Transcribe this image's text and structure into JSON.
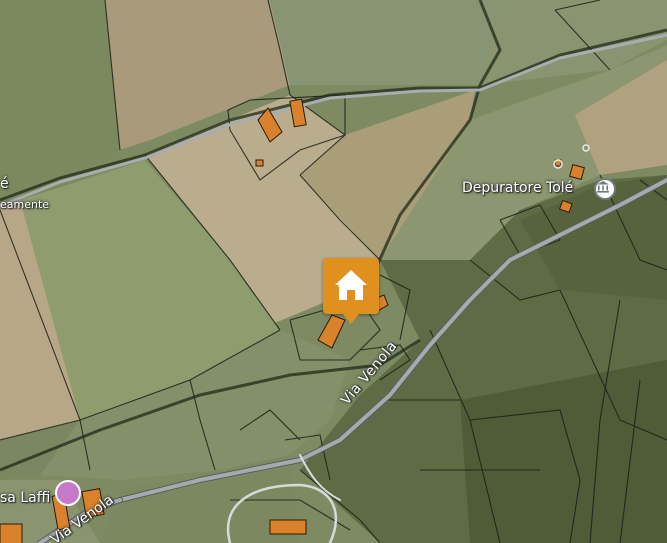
{
  "map": {
    "labels": {
      "depuratore": "Depuratore Tolé",
      "via_venola_main": "Via Venola",
      "via_venola_bottom": "Via Venola",
      "laffi": "sa Laffi",
      "edge_left_top": "é",
      "edge_left_mid": "eamente"
    },
    "icons": {
      "home_marker": "home-icon",
      "depuratore_poi": "museum-icon",
      "laffi_poi": "place-icon"
    },
    "colors": {
      "marker": "#e0901f",
      "building": "#d9822b",
      "road": "#9aa0a6",
      "boundary": "#1b1f17"
    }
  }
}
